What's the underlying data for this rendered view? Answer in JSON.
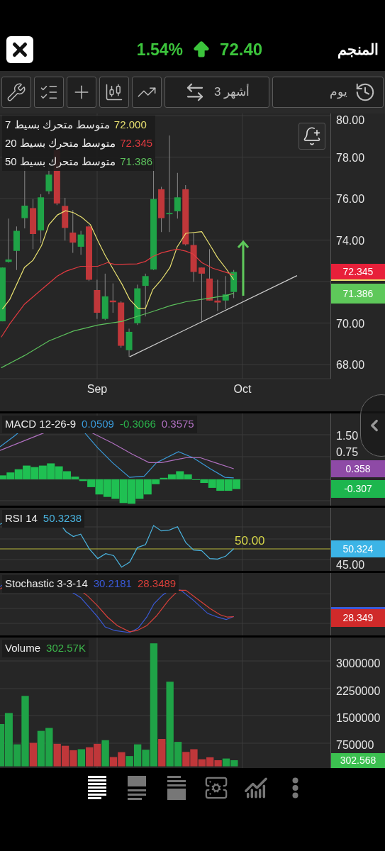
{
  "header": {
    "change_percent": "1.54%",
    "price": "72.40",
    "name": "المنجم"
  },
  "toolbar": {
    "period": "3 أشهر",
    "interval": "يوم"
  },
  "price_chart": {
    "legend": [
      {
        "label": "متوسط متحرك بسيط 7",
        "value": "72.000",
        "color": "#e8e070"
      },
      {
        "label": "متوسط متحرك بسيط 20",
        "value": "72.345",
        "color": "#e03a40"
      },
      {
        "label": "متوسط متحرك بسيط 50",
        "value": "71.386",
        "color": "#5cc05c"
      }
    ],
    "y_axis": [
      "80.00",
      "78.00",
      "76.00",
      "74.00",
      "70.00",
      "68.00"
    ],
    "x_axis": [
      "Sep",
      "Oct"
    ],
    "tags": [
      {
        "value": "72.345",
        "color": "#e8203a"
      },
      {
        "value": "71.386",
        "color": "#5ec85a"
      }
    ]
  },
  "macd": {
    "label": "MACD 12-26-9",
    "values": [
      {
        "value": "0.0509",
        "color": "#3a9ad9"
      },
      {
        "value": "-0.3066",
        "color": "#2bb34b"
      },
      {
        "value": "0.3575",
        "color": "#b070c0"
      }
    ],
    "y_axis": [
      "1.50",
      "0.75"
    ],
    "tags": [
      {
        "value": "0.358",
        "color": "#8e4aa6"
      },
      {
        "value": "-0.307",
        "color": "#1db64e"
      }
    ]
  },
  "rsi": {
    "label": "RSI 14",
    "values": [
      {
        "value": "50.3238",
        "color": "#4ab4e0"
      }
    ],
    "reference": "50.00",
    "y_axis": [
      "45.00"
    ],
    "tags": [
      {
        "value": "50.324",
        "color": "#3cb4e6"
      }
    ]
  },
  "stochastic": {
    "label": "Stochastic 3-3-14",
    "values": [
      {
        "value": "30.2181",
        "color": "#3a5ad9"
      },
      {
        "value": "28.3489",
        "color": "#d9403a"
      }
    ],
    "tags": [
      {
        "value": "28.349",
        "color": "#d02a2a"
      }
    ]
  },
  "volume": {
    "label": "Volume",
    "values": [
      {
        "value": "302.57K",
        "color": "#3cb44b"
      }
    ],
    "y_axis": [
      "3000000",
      "2250000",
      "1500000",
      "750000"
    ],
    "tags": [
      {
        "value": "302.568",
        "color": "#3cc050"
      }
    ]
  },
  "bottom_nav": [
    {
      "selected": true
    },
    {
      "selected": false
    },
    {
      "selected": false
    },
    {
      "selected": false
    },
    {
      "selected": false
    },
    {
      "selected": false
    }
  ]
}
